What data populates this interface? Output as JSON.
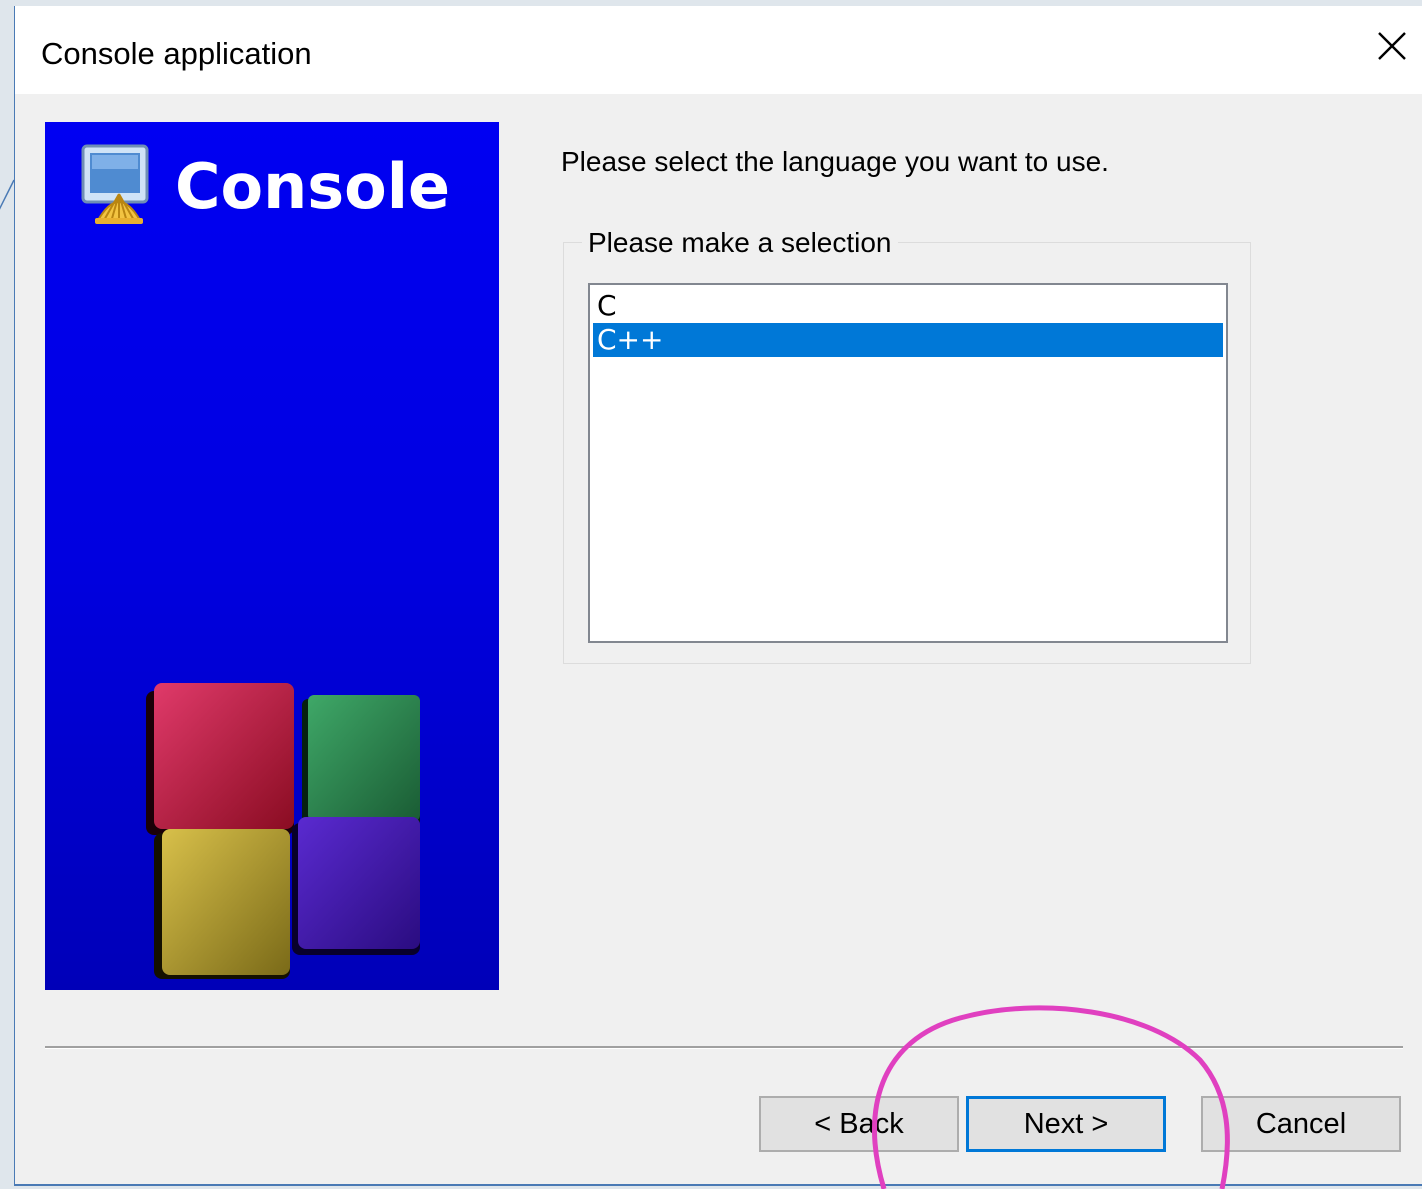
{
  "window": {
    "title": "Console application"
  },
  "banner": {
    "title": "Console"
  },
  "main": {
    "prompt": "Please select the language you want to use.",
    "group_label": "Please make a selection",
    "languages": [
      {
        "label": "C",
        "selected": false
      },
      {
        "label": "C++",
        "selected": true
      }
    ]
  },
  "buttons": {
    "back": "< Back",
    "next": "Next >",
    "cancel": "Cancel"
  },
  "colors": {
    "selection": "#0078d7",
    "banner_blue": "#0000f2",
    "annotation_circle": "#e040c0"
  },
  "icons": [
    "close-icon",
    "console-app-icon",
    "codeblocks-cubes-logo"
  ]
}
